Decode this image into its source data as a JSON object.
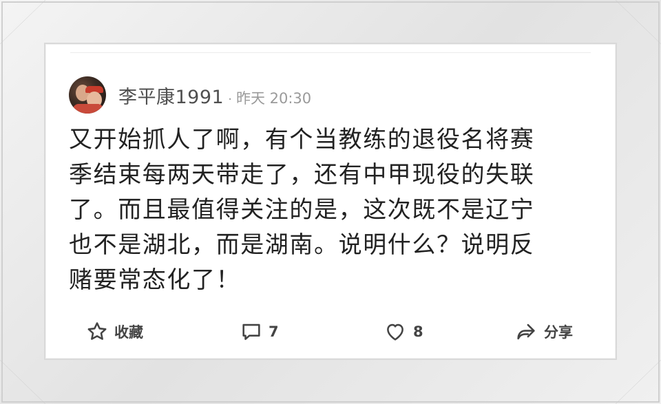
{
  "post": {
    "username": "李平康1991",
    "separator": "·",
    "time": "昨天 20:30",
    "content": "又开始抓人了啊，有个当教练的退役名将赛\n季结束每两天带走了，还有中甲现役的失联\n了。而且最值得关注的是，这次既不是辽宁\n也不是湖北，而是湖南。说明什么？说明反\n赌要常态化了！"
  },
  "actions": {
    "favorite": {
      "label": "收藏",
      "icon": "star-outline-icon"
    },
    "comment": {
      "count": "7",
      "icon": "comment-bubble-icon"
    },
    "like": {
      "count": "8",
      "icon": "heart-outline-icon"
    },
    "share": {
      "label": "分享",
      "icon": "share-arrow-icon"
    }
  },
  "colors": {
    "text_primary": "#222222",
    "text_username": "#4f4f4f",
    "text_muted": "#9a9a9a",
    "icon": "#444444",
    "frame": "#e6e6e6"
  }
}
